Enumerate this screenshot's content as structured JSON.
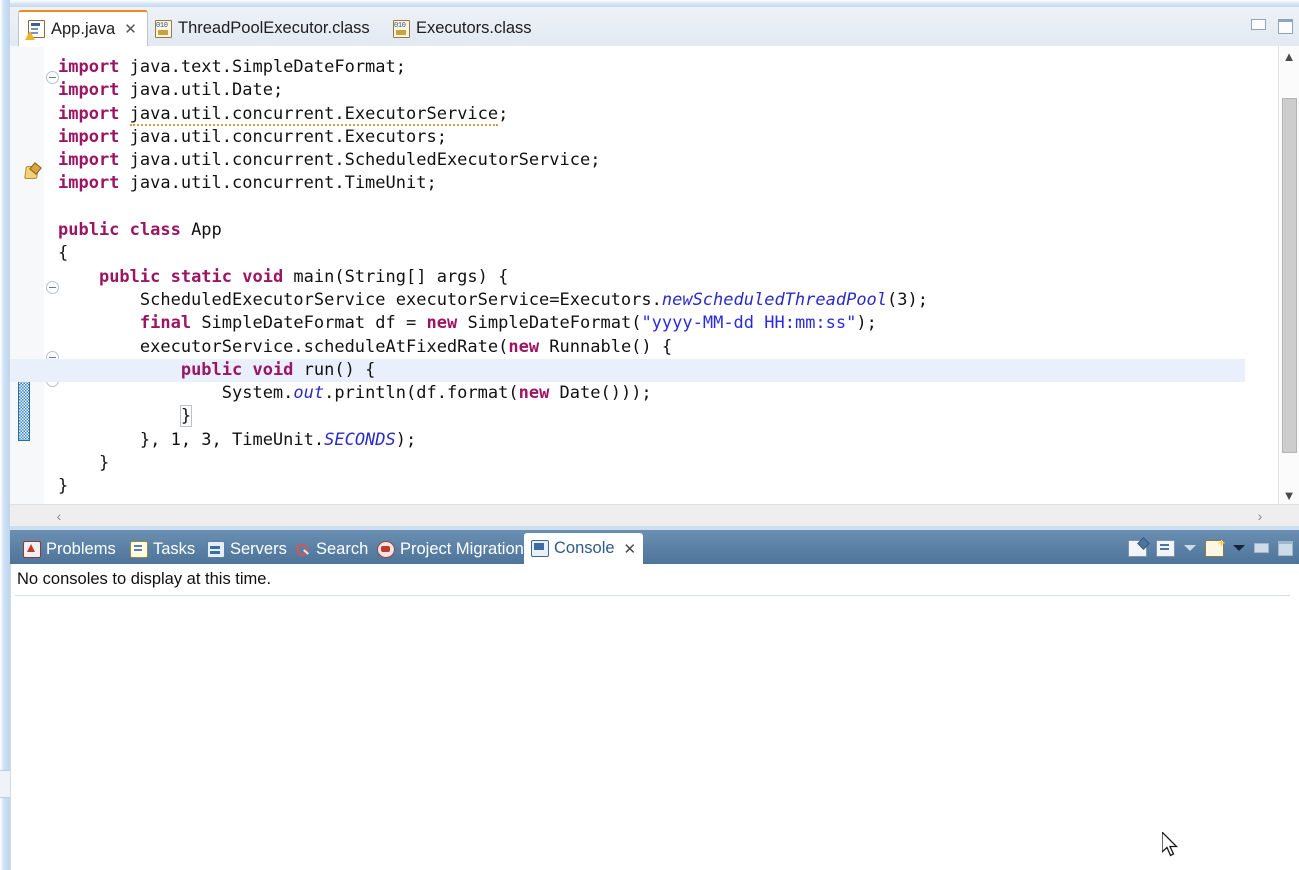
{
  "editor": {
    "tabs": [
      {
        "label": "App.java",
        "icon": "java-file-warning-icon",
        "active": true,
        "closable": true
      },
      {
        "label": "ThreadPoolExecutor.class",
        "icon": "class-file-icon",
        "active": false,
        "closable": false
      },
      {
        "label": "Executors.class",
        "icon": "class-file-icon",
        "active": false,
        "closable": false
      }
    ],
    "window_buttons": [
      {
        "name": "minimize-button",
        "label": "minimize-icon"
      },
      {
        "name": "maximize-button",
        "label": "maximize-icon"
      }
    ],
    "gutter": {
      "warning_marker_icon": "quickfix-warning-icon",
      "change_bar": "modified-lines-change-bar",
      "fold_markers": [
        "collapse-icon",
        "collapse-icon",
        "collapse-icon",
        "collapse-icon"
      ]
    },
    "code_lines": [
      {
        "n": 1,
        "fold": true,
        "text": "import java.text.SimpleDateFormat;"
      },
      {
        "n": 2,
        "fold": false,
        "text": "import java.util.Date;"
      },
      {
        "n": 3,
        "fold": false,
        "text": "import java.util.concurrent.ExecutorService;",
        "warning": true
      },
      {
        "n": 4,
        "fold": false,
        "text": "import java.util.concurrent.Executors;"
      },
      {
        "n": 5,
        "fold": false,
        "text": "import java.util.concurrent.ScheduledExecutorService;"
      },
      {
        "n": 6,
        "fold": false,
        "text": "import java.util.concurrent.TimeUnit;"
      },
      {
        "n": 7,
        "fold": false,
        "text": ""
      },
      {
        "n": 8,
        "fold": false,
        "text": "public class App"
      },
      {
        "n": 9,
        "fold": false,
        "text": "{"
      },
      {
        "n": 10,
        "fold": true,
        "text": "    public static void main(String[] args) {"
      },
      {
        "n": 11,
        "fold": false,
        "text": "        ScheduledExecutorService executorService=Executors.newScheduledThreadPool(3);"
      },
      {
        "n": 12,
        "fold": false,
        "text": "        final SimpleDateFormat df = new SimpleDateFormat(\"yyyy-MM-dd HH:mm:ss\");"
      },
      {
        "n": 13,
        "fold": true,
        "text": "        executorService.scheduleAtFixedRate(new Runnable() {"
      },
      {
        "n": 14,
        "fold": true,
        "text": "            public void run() {",
        "current": true
      },
      {
        "n": 15,
        "fold": false,
        "text": "                System.out.println(df.format(new Date()));"
      },
      {
        "n": 16,
        "fold": false,
        "text": "            }"
      },
      {
        "n": 17,
        "fold": false,
        "text": "        }, 1, 3, TimeUnit.SECONDS);"
      },
      {
        "n": 18,
        "fold": false,
        "text": "    }"
      },
      {
        "n": 19,
        "fold": false,
        "text": "}"
      }
    ],
    "scrollbars": {
      "vertical_up": "▲",
      "vertical_down": "▼",
      "horizontal_left": "‹",
      "horizontal_right": "›"
    }
  },
  "console_panel": {
    "tabs": [
      {
        "label": "Problems",
        "icon": "problems-icon",
        "active": false,
        "closable": false
      },
      {
        "label": "Tasks",
        "icon": "tasks-icon",
        "active": false,
        "closable": false
      },
      {
        "label": "Servers",
        "icon": "servers-icon",
        "active": false,
        "closable": false
      },
      {
        "label": "Search",
        "icon": "search-icon",
        "active": false,
        "closable": false
      },
      {
        "label": "Project Migration",
        "icon": "project-migration-icon",
        "active": false,
        "closable": false
      },
      {
        "label": "Console",
        "icon": "console-icon",
        "active": true,
        "closable": true
      }
    ],
    "toolbar": [
      {
        "name": "pin-console-button",
        "icon": "pin-console-icon"
      },
      {
        "name": "display-selected-console-button",
        "icon": "display-console-icon"
      },
      {
        "name": "display-selected-console-dropdown",
        "icon": "chevron-down-icon"
      },
      {
        "name": "open-console-button",
        "icon": "new-console-icon"
      },
      {
        "name": "open-console-dropdown",
        "icon": "chevron-down-icon"
      },
      {
        "name": "minimize-panel-button",
        "icon": "minimize-icon"
      },
      {
        "name": "maximize-panel-button",
        "icon": "maximize-icon"
      }
    ],
    "message": "No consoles to display at this time."
  },
  "cursor": {
    "name": "mouse-pointer",
    "icon": "arrow-cursor"
  },
  "colors": {
    "keyword": "#9b1563",
    "string": "#2a2ae0",
    "static_field": "#2b2bc8",
    "current_line": "#e9f0fb",
    "panel_tabbar": "#4d7599",
    "active_tab_accent": "#f08a1e"
  }
}
